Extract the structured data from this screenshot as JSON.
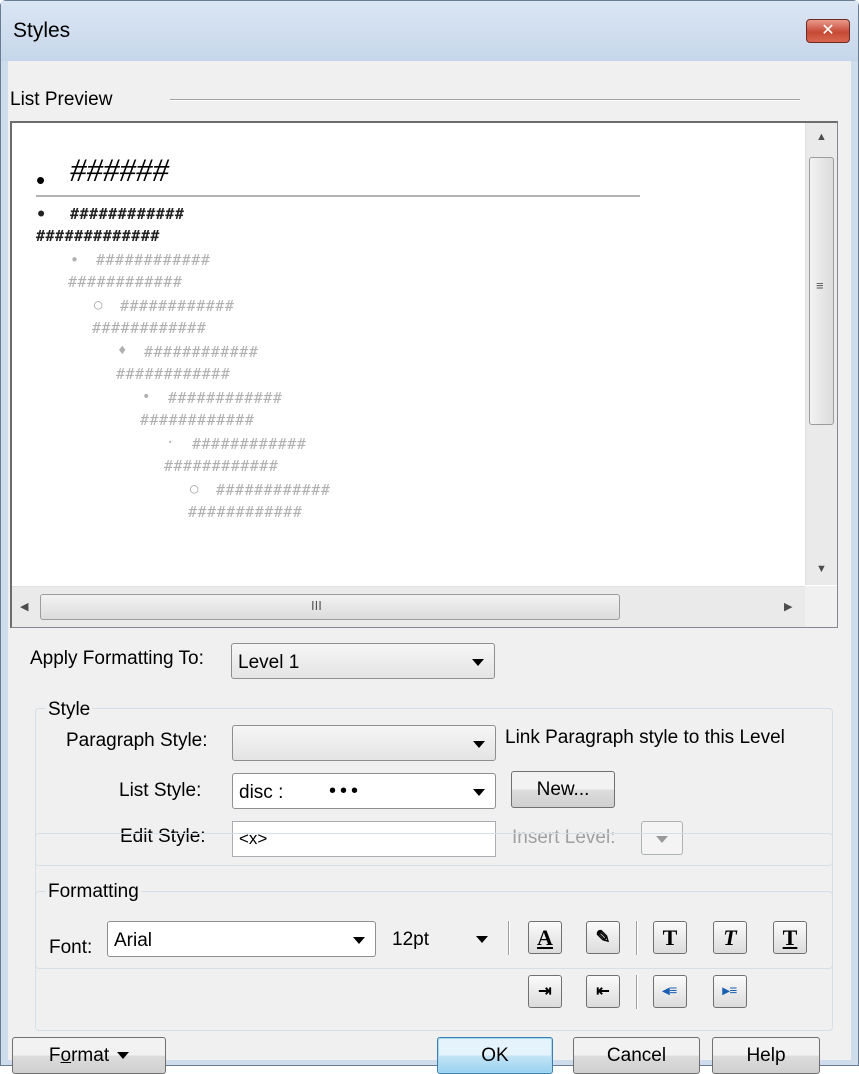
{
  "window": {
    "title": "Styles",
    "close_glyph": "✕"
  },
  "preview": {
    "label": "List Preview",
    "level1_bullet": "•",
    "level1_text": "######",
    "rows": [
      {
        "bullet": "•",
        "line1": "############",
        "line2": "#############"
      },
      {
        "bullet": "•",
        "line1": "############",
        "line2": "############"
      },
      {
        "bullet": "○",
        "line1": "############",
        "line2": "############"
      },
      {
        "bullet": "♦",
        "line1": "############",
        "line2": "############"
      },
      {
        "bullet": "•",
        "line1": "############",
        "line2": "############"
      },
      {
        "bullet": "·",
        "line1": "############",
        "line2": "############"
      },
      {
        "bullet": "○",
        "line1": "############",
        "line2": "############"
      }
    ],
    "scroll_grip_v": "≡",
    "scroll_grip_h": "III"
  },
  "apply": {
    "label": "Apply Formatting To:",
    "value": "Level 1"
  },
  "style_group": {
    "title": "Style",
    "paragraph_label": "Paragraph Style:",
    "paragraph_value": "",
    "link_text": "Link Paragraph style to this Level",
    "list_label": "List Style:",
    "list_value": "disc :",
    "list_preview": "•••",
    "new_button": "New...",
    "edit_label": "Edit Style:",
    "edit_value": "<x>",
    "insert_label": "Insert Level:"
  },
  "formatting_group": {
    "title": "Formatting",
    "font_label": "Font:",
    "font_value": "Arial",
    "size_value": "12pt"
  },
  "footer": {
    "format_prefix": "F",
    "format_underlined": "o",
    "format_suffix": "rmat",
    "ok": "OK",
    "cancel": "Cancel",
    "help": "Help"
  },
  "colors": {
    "titlebar": "#c6d6ea",
    "close_button": "#c54a35",
    "dialog_background": "#f0f0f0",
    "default_button": "#98d1ef"
  },
  "icons": [
    "close-icon",
    "font-color-icon",
    "highlight-icon",
    "bold-icon",
    "italic-icon",
    "underline-icon",
    "indent-icon",
    "outdent-icon",
    "decrease-indent-icon",
    "increase-indent-icon"
  ]
}
